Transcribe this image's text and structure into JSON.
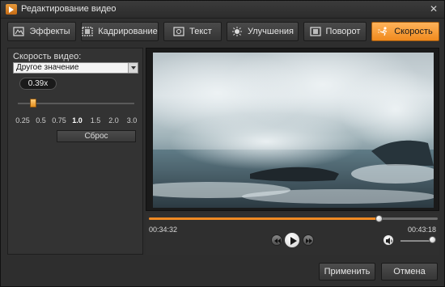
{
  "window": {
    "title": "Редактирование видео",
    "close_glyph": "✕"
  },
  "tabs": [
    {
      "label": "Эффекты",
      "icon": "effects-icon",
      "active": false
    },
    {
      "label": "Кадрирование",
      "icon": "crop-icon",
      "active": false
    },
    {
      "label": "Текст",
      "icon": "text-icon",
      "active": false
    },
    {
      "label": "Улучшения",
      "icon": "enhance-icon",
      "active": false
    },
    {
      "label": "Поворот",
      "icon": "rotate-icon",
      "active": false
    },
    {
      "label": "Скорость",
      "icon": "speed-icon",
      "active": true
    }
  ],
  "speed": {
    "label": "Скорость видео:",
    "preset_value": "Другое значение",
    "current_value": "0.39x",
    "slider_value": 0.39,
    "scale": [
      "0.25",
      "0.5",
      "0.75",
      "1.0",
      "1.5",
      "2.0",
      "3.0"
    ],
    "reset_label": "Сброс"
  },
  "player": {
    "current_time": "00:34:32",
    "total_time": "00:43:18",
    "progress_fraction": 0.797,
    "volume_fraction": 1.0
  },
  "footer": {
    "apply_label": "Применить",
    "cancel_label": "Отмена"
  },
  "colors": {
    "accent": "#f08a1e",
    "background": "#2e2e2e"
  }
}
